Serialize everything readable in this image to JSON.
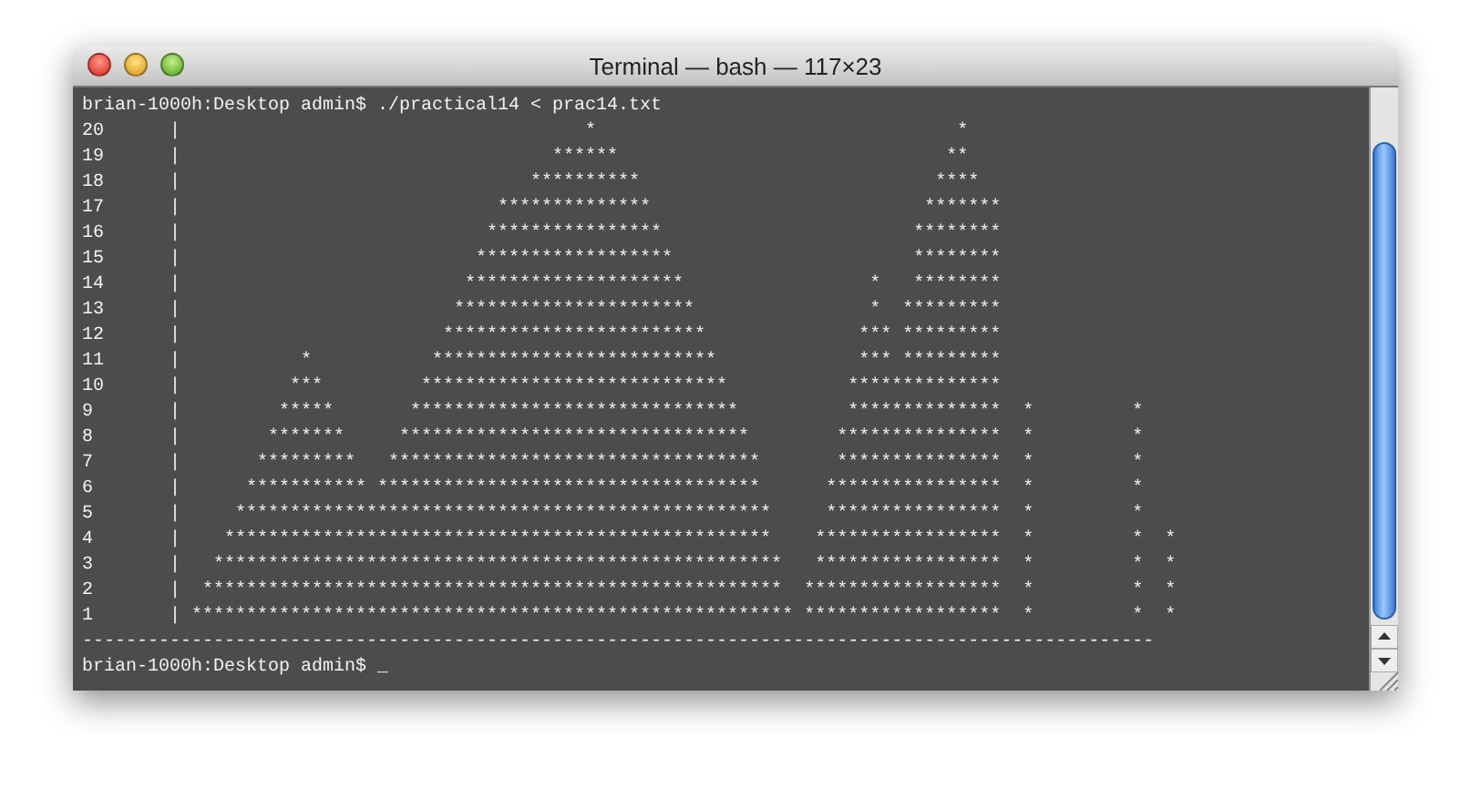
{
  "window": {
    "title": "Terminal — bash — 117×23"
  },
  "terminal": {
    "command_line": "brian-1000h:Desktop admin$ ./practical14 < prac14.txt",
    "output_lines": [
      "20      |                                     *                                 *",
      "19      |                                  ******                              **",
      "18      |                                **********                           ****",
      "17      |                             **************                         *******",
      "16      |                            ****************                       ********",
      "15      |                           ******************                      ********",
      "14      |                          ********************                 *   ********",
      "13      |                         **********************                *  *********",
      "12      |                        ************************              *** *********",
      "11      |           *           **************************             *** *********",
      "10      |          ***         ****************************           **************",
      "9       |         *****       ******************************          **************  *         *",
      "8       |        *******     ********************************        ***************  *         *",
      "7       |       *********   **********************************       ***************  *         *",
      "6       |      *********** ***********************************      ****************  *         *",
      "5       |     *************************************************     ****************  *         *",
      "4       |    **************************************************    *****************  *         *  *",
      "3       |   ****************************************************   *****************  *         *  *",
      "2       |  *****************************************************  ******************  *         *  *",
      "1       | ******************************************************* ******************  *         *  *",
      "--------------------------------------------------------------------------------------------------"
    ],
    "prompt": "brian-1000h:Desktop admin$ ",
    "cursor": "_"
  }
}
